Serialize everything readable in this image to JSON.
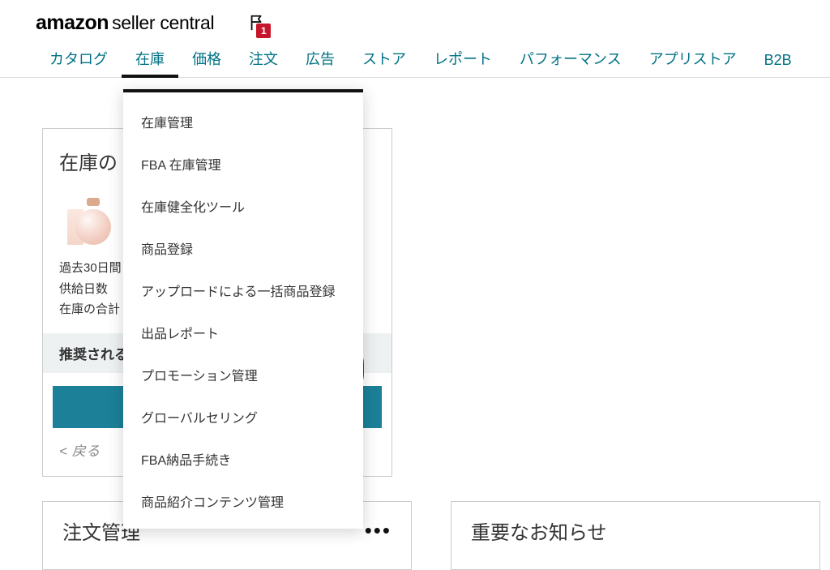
{
  "brand": {
    "amazon": "amazon",
    "seller_central": "seller central"
  },
  "notif_count": "1",
  "nav": {
    "items": [
      "カタログ",
      "在庫",
      "価格",
      "注文",
      "広告",
      "ストア",
      "レポート",
      "パフォーマンス",
      "アプリストア",
      "B2B"
    ],
    "active_index": 1
  },
  "dropdown": {
    "items": [
      "在庫管理",
      "FBA 在庫管理",
      "在庫健全化ツール",
      "商品登録",
      "アップロードによる一括商品登録",
      "出品レポート",
      "プロモーション管理",
      "グローバルセリング",
      "FBA納品手続き",
      "商品紹介コンテンツ管理"
    ],
    "highlight_index": 4
  },
  "inventory_card": {
    "title_prefix": "在庫の",
    "stat_lines": [
      "過去30日間",
      "供給日数",
      "在庫の合計"
    ],
    "reco_prefix": "推奨される",
    "back": "< 戻る"
  },
  "bottom": {
    "left_title": "注文管理",
    "right_title": "重要なお知らせ",
    "dots": "•••"
  }
}
